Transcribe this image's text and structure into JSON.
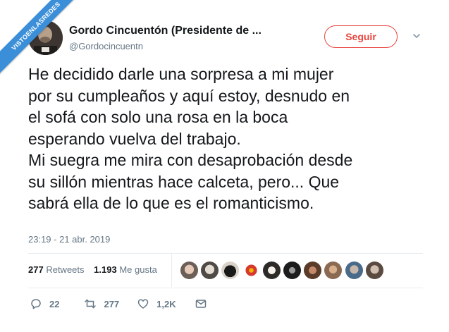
{
  "watermark": {
    "text": "VISTOENLASREDES"
  },
  "author": {
    "name": "Gordo Cincuentón (Presidente de ...",
    "handle": "@Gordocincuentn"
  },
  "follow_button": {
    "label": "Seguir"
  },
  "tweet": {
    "lines": [
      "He decidido darle una sorpresa a mi mujer",
      "por su cumpleaños y aquí estoy, desnudo en",
      "el sofá con solo una rosa en la boca",
      "esperando vuelva del trabajo.",
      "Mi suegra me mira con desaprobación desde",
      "su sillón mientras hace calceta, pero... Que",
      "sabrá ella de lo que es el romanticismo."
    ],
    "timestamp": "23:19 - 21 abr. 2019"
  },
  "stats": {
    "retweets_count": "277",
    "retweets_label": "Retweets",
    "likes_count": "1.193",
    "likes_label": "Me gusta"
  },
  "actions": {
    "replies": "22",
    "retweets": "277",
    "likes": "1,2K"
  },
  "colors": {
    "accent": "#e8453e",
    "watermark": "#3b8ed8",
    "muted": "#657786",
    "text": "#14171a"
  },
  "icons": [
    "reply-icon",
    "retweet-icon",
    "heart-icon",
    "envelope-icon",
    "chevron-down-icon"
  ]
}
